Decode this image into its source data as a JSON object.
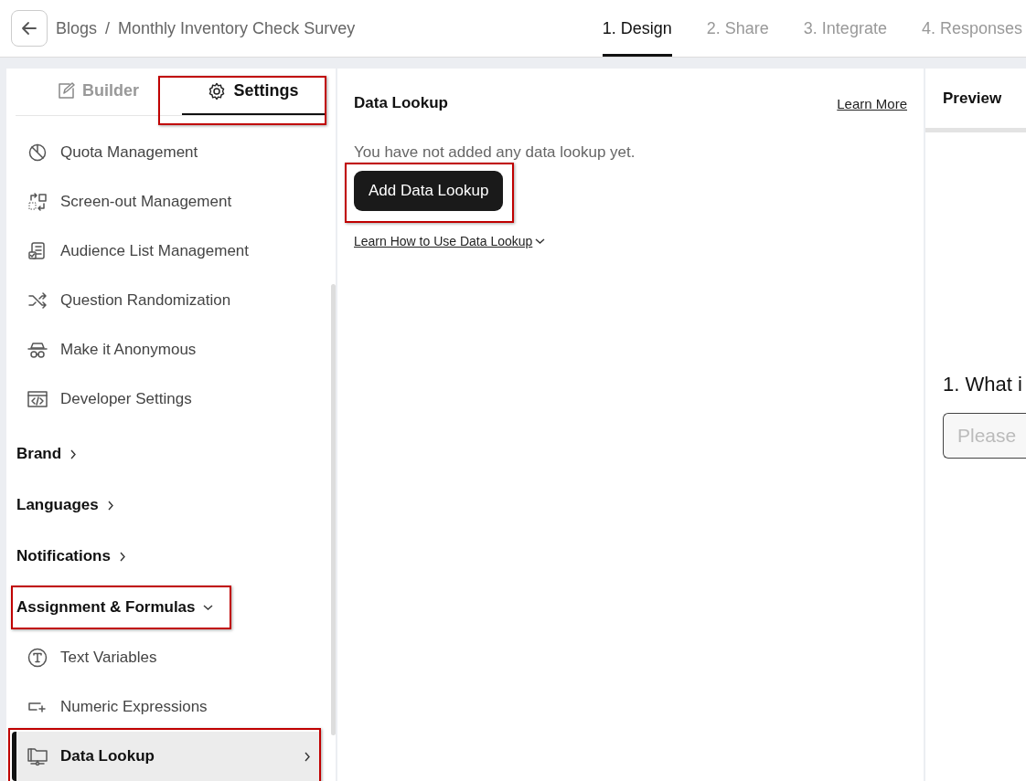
{
  "header": {
    "breadcrumb": [
      {
        "label": "Blogs"
      },
      {
        "label": "/"
      },
      {
        "label": "Monthly Inventory Check Survey"
      }
    ],
    "steps": [
      {
        "label": "1. Design",
        "selected": true
      },
      {
        "label": "2. Share",
        "selected": false
      },
      {
        "label": "3. Integrate",
        "selected": false
      },
      {
        "label": "4. Responses",
        "selected": false
      }
    ]
  },
  "sidebar": {
    "tabs": [
      {
        "label": "Builder",
        "selected": false,
        "highlighted": false
      },
      {
        "label": "Settings",
        "selected": true,
        "highlighted": true
      }
    ],
    "items": [
      {
        "kind": "item",
        "label": "Quota Management",
        "selected": false,
        "highlighted": false
      },
      {
        "kind": "item",
        "label": "Screen-out Management",
        "selected": false,
        "highlighted": false
      },
      {
        "kind": "item",
        "label": "Audience List Management",
        "selected": false,
        "highlighted": false
      },
      {
        "kind": "item",
        "label": "Question Randomization",
        "selected": false,
        "highlighted": false
      },
      {
        "kind": "item",
        "label": "Make it Anonymous",
        "selected": false,
        "highlighted": false
      },
      {
        "kind": "item",
        "label": "Developer Settings",
        "selected": false,
        "highlighted": false
      },
      {
        "kind": "section",
        "label": "Brand",
        "expanded": false,
        "highlighted": false
      },
      {
        "kind": "section",
        "label": "Languages",
        "expanded": false,
        "highlighted": false
      },
      {
        "kind": "section",
        "label": "Notifications",
        "expanded": false,
        "highlighted": false
      },
      {
        "kind": "section",
        "label": "Assignment & Formulas",
        "expanded": true,
        "highlighted": true,
        "children": [
          {
            "kind": "item",
            "label": "Text Variables",
            "selected": false,
            "highlighted": false
          },
          {
            "kind": "item",
            "label": "Numeric Expressions",
            "selected": false,
            "highlighted": false
          },
          {
            "kind": "item",
            "label": "Data Lookup",
            "selected": true,
            "highlighted": true
          }
        ]
      }
    ]
  },
  "main": {
    "title": "Data Lookup",
    "learn_more": "Learn More",
    "empty_text": "You have not added any data lookup yet.",
    "button": {
      "label": "Add Data Lookup",
      "highlighted": true
    },
    "help_link": "Learn How to Use Data Lookup"
  },
  "preview": {
    "tab": "Preview",
    "question": "1. What i",
    "placeholder": "Please"
  }
}
